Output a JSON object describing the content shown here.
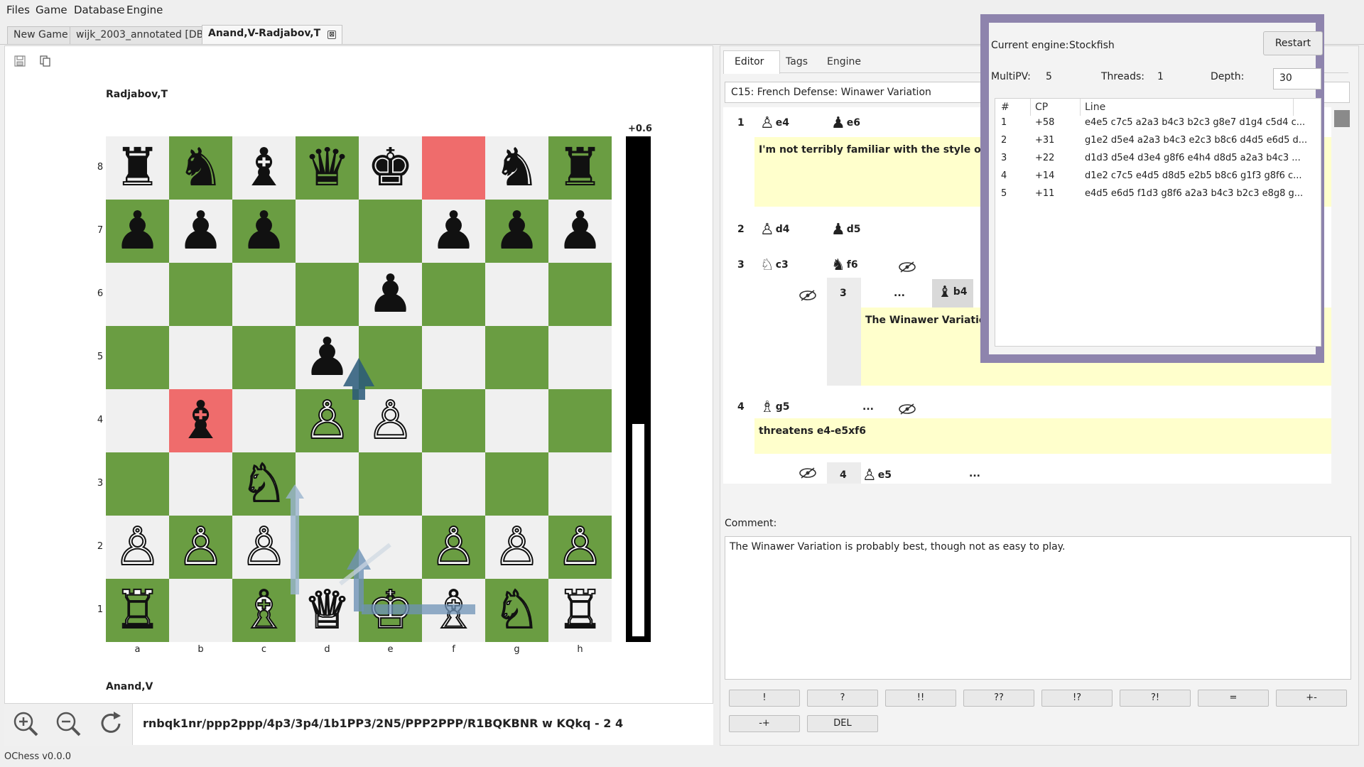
{
  "menu": [
    "Files",
    "Game",
    "Database",
    "Engine"
  ],
  "tabs": [
    {
      "label": "New Game",
      "active": false
    },
    {
      "label": "wijk_2003_annotated [DB]",
      "active": false
    },
    {
      "label": "Anand,V-Radjabov,T",
      "active": true
    }
  ],
  "tab_close_glyph": "⊠",
  "board": {
    "top_player": "Radjabov,T",
    "bottom_player": "Anand,V",
    "eval": "+0.6",
    "eval_white_fraction": 0.43,
    "files": [
      "a",
      "b",
      "c",
      "d",
      "e",
      "f",
      "g",
      "h"
    ],
    "ranks": [
      "8",
      "7",
      "6",
      "5",
      "4",
      "3",
      "2",
      "1"
    ],
    "position": [
      [
        "r",
        "n",
        "b",
        "q",
        "k",
        "",
        "n",
        "r"
      ],
      [
        "p",
        "p",
        "p",
        "",
        "",
        "p",
        "p",
        "p"
      ],
      [
        "",
        "",
        "",
        "",
        "p",
        "",
        "",
        ""
      ],
      [
        "",
        "",
        "",
        "p",
        "",
        "",
        "",
        ""
      ],
      [
        "",
        "b",
        "",
        "P",
        "P",
        "",
        "",
        ""
      ],
      [
        "",
        "",
        "N",
        "",
        "",
        "",
        "",
        ""
      ],
      [
        "P",
        "P",
        "P",
        "",
        "",
        "P",
        "P",
        "P"
      ],
      [
        "R",
        "",
        "B",
        "Q",
        "K",
        "B",
        "N",
        "R"
      ]
    ],
    "highlight_squares": [
      "f8",
      "b4"
    ],
    "colors": {
      "light": "#f0f0f0",
      "dark": "#6a9d42",
      "highlight_light": "#fdbfbf",
      "highlight_dark": "#ef6c6c"
    }
  },
  "fen": "rnbqk1nr/ppp2ppp/4p3/3p4/1b1PP3/2N5/PPP2PPP/R1BQKBNR w KQkq - 2 4",
  "toolbar_icons": [
    "save-icon",
    "copy-icon"
  ],
  "zoom_icons": [
    "zoom-in-icon",
    "zoom-out-icon",
    "flip-board-icon"
  ],
  "right_tabs": [
    "Editor",
    "Tags",
    "Engine"
  ],
  "opening": "C15: French Defense: Winawer Variation",
  "moves": {
    "m1": {
      "num": "1",
      "white": "e4",
      "black": "e6"
    },
    "c1": "I'm not terribly familiar with the style of Radja bov, so I don't know if this is his usual opening.",
    "m2": {
      "num": "2",
      "white": "d4",
      "black": "d5"
    },
    "m3": {
      "num": "3",
      "white": "c3",
      "black": "f6"
    },
    "v3": {
      "num": "3",
      "dots": "...",
      "black": "b4"
    },
    "c3": "The Winawer Variation i t as easy to play.",
    "m4": {
      "num": "4",
      "white": "g5",
      "dots": "..."
    },
    "c4": "threatens e4-e5xf6",
    "v4": {
      "num": "4",
      "white": "e5",
      "dots": "..."
    }
  },
  "comment_label": "Comment:",
  "comment_text": "The Winawer Variation is probably best, though not as easy to play.",
  "nag_buttons_row1": [
    "!",
    "?",
    "!!",
    "??",
    "!?",
    "?!",
    "=",
    "+-"
  ],
  "nag_buttons_row2": [
    "-+",
    "DEL"
  ],
  "engine": {
    "current_label": "Current engine:",
    "name": "Stockfish",
    "restart": "Restart",
    "multipv_label": "MultiPV:",
    "multipv": "5",
    "threads_label": "Threads:",
    "threads": "1",
    "depth_label": "Depth:",
    "depth": "30",
    "columns": [
      "#",
      "CP",
      "Line"
    ],
    "rows": [
      {
        "n": "1",
        "cp": "+58",
        "line": "e4e5 c7c5 a2a3 b4c3 b2c3 g8e7 d1g4 c5d4 c..."
      },
      {
        "n": "2",
        "cp": "+31",
        "line": "g1e2 d5e4 a2a3 b4c3 e2c3 b8c6 d4d5 e6d5 d..."
      },
      {
        "n": "3",
        "cp": "+22",
        "line": "d1d3 d5e4 d3e4 g8f6 e4h4 d8d5 a2a3 b4c3 ..."
      },
      {
        "n": "4",
        "cp": "+14",
        "line": "d1e2 c7c5 e4d5 d8d5 e2b5 b8c6 g1f3 g8f6 c..."
      },
      {
        "n": "5",
        "cp": "+11",
        "line": "e4d5 e6d5 f1d3 g8f6 a2a3 b4c3 b2c3 e8g8 g..."
      }
    ]
  },
  "status": "OChess v0.0.0"
}
